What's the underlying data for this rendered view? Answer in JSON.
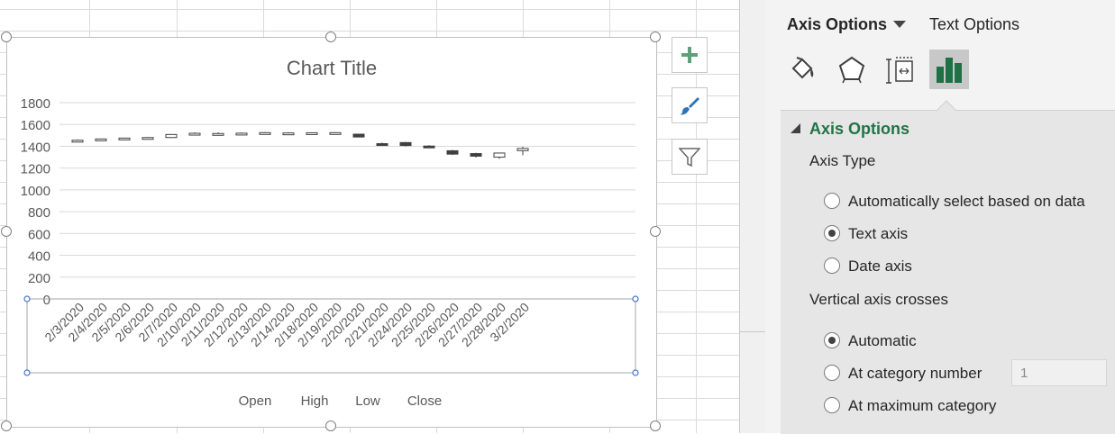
{
  "chart": {
    "title": "Chart Title",
    "legend": [
      "Open",
      "High",
      "Low",
      "Close"
    ]
  },
  "chart_data": {
    "type": "candlestick",
    "title": "Chart Title",
    "categories": [
      "2/3/2020",
      "2/4/2020",
      "2/5/2020",
      "2/6/2020",
      "2/7/2020",
      "2/10/2020",
      "2/11/2020",
      "2/12/2020",
      "2/13/2020",
      "2/14/2020",
      "2/18/2020",
      "2/19/2020",
      "2/20/2020",
      "2/21/2020",
      "2/24/2020",
      "2/25/2020",
      "2/26/2020",
      "2/27/2020",
      "2/28/2020",
      "3/2/2020"
    ],
    "series": [
      {
        "name": "Open",
        "values": [
          1444,
          1455,
          1460,
          1474,
          1480,
          1513,
          1510,
          1516,
          1519,
          1519,
          1519,
          1519,
          1511,
          1424,
          1434,
          1402,
          1359,
          1333,
          1300,
          1360
        ]
      },
      {
        "name": "High",
        "values": [
          1462,
          1470,
          1478,
          1485,
          1511,
          1528,
          1528,
          1526,
          1530,
          1529,
          1528,
          1530,
          1510,
          1434,
          1440,
          1410,
          1366,
          1340,
          1325,
          1395
        ]
      },
      {
        "name": "Low",
        "values": [
          1443,
          1450,
          1455,
          1467,
          1477,
          1509,
          1508,
          1510,
          1512,
          1513,
          1513,
          1515,
          1488,
          1412,
          1397,
          1384,
          1320,
          1296,
          1285,
          1318
        ]
      },
      {
        "name": "Close",
        "values": [
          1455,
          1467,
          1475,
          1480,
          1508,
          1519,
          1517,
          1520,
          1525,
          1522,
          1524,
          1525,
          1485,
          1418,
          1407,
          1392,
          1328,
          1309,
          1338,
          1380
        ]
      }
    ],
    "ylim": [
      0,
      1800
    ],
    "yticks": [
      0,
      200,
      400,
      600,
      800,
      1000,
      1200,
      1400,
      1600,
      1800
    ],
    "grid": true,
    "legend_position": "bottom"
  },
  "chart_buttons": [
    {
      "name": "chart-elements-button",
      "icon": "plus-icon"
    },
    {
      "name": "chart-styles-button",
      "icon": "brush-icon"
    },
    {
      "name": "chart-filters-button",
      "icon": "filter-icon"
    }
  ],
  "pane": {
    "tab_axis": "Axis Options",
    "tab_text": "Text Options",
    "icons": [
      "fill-line-icon",
      "effects-icon",
      "size-properties-icon",
      "axis-options-icon"
    ],
    "section_title": "Axis Options",
    "axis_type_label": "Axis Type",
    "axis_type_options": [
      "Automatically select based on data",
      "Text axis",
      "Date axis"
    ],
    "axis_type_selected": 1,
    "crosses_label": "Vertical axis crosses",
    "crosses_options": [
      "Automatic",
      "At category number",
      "At maximum category"
    ],
    "crosses_selected": 0,
    "category_number_value": "1"
  },
  "colors": {
    "accent_green": "#217346",
    "excel_green_icon": "#1e7145",
    "down_candle": "#404040",
    "selection_blue": "#4472c4"
  }
}
